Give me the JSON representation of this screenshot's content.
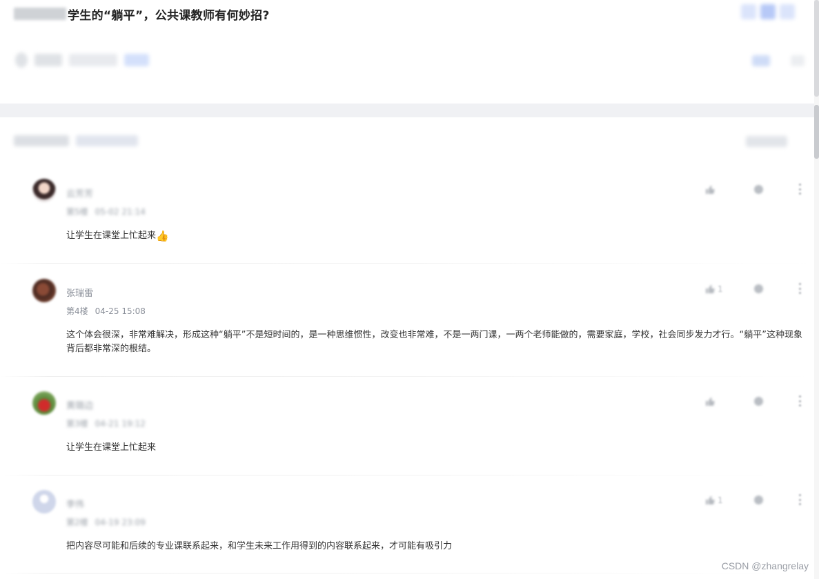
{
  "post": {
    "title": "学生的“躺平”，公共课教师有何妙招?"
  },
  "comments": [
    {
      "username": "",
      "floor": "",
      "time": "",
      "text": "让学生在课堂上忙起来",
      "emoji": "👍",
      "likes": ""
    },
    {
      "username": "张瑞雷",
      "floor": "第4楼",
      "time": "04-25 15:08",
      "text": "这个体会很深，非常难解决，形成这种“躺平”不是短时间的，是一种思维惯性，改变也非常难，不是一两门课，一两个老师能做的，需要家庭，学校，社会同步发力才行。“躺平”这种现象背后都非常深的根结。",
      "likes": "1"
    },
    {
      "username": "",
      "floor": "",
      "time": "",
      "text": "让学生在课堂上忙起来",
      "likes": ""
    },
    {
      "username": "",
      "floor": "",
      "time": "",
      "text": "把内容尽可能和后续的专业课联系起来，和学生未来工作用得到的内容联系起来，才可能有吸引力",
      "likes": "1"
    }
  ],
  "icons": {
    "like": "thumbs-up-icon",
    "reply": "comment-bubble-icon",
    "more": "more-vertical-icon"
  },
  "watermark": "CSDN @zhangrelay"
}
